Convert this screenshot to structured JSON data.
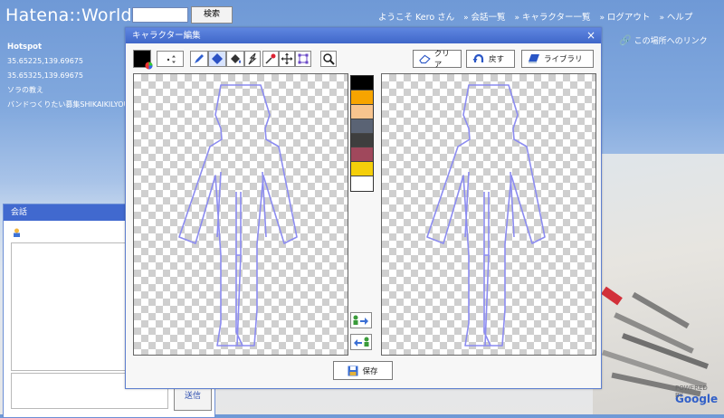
{
  "topbar": {
    "logo": "Hatena::World",
    "search_label": "検索",
    "greeting": "ようこそ Kero さん",
    "nav": [
      "会話一覧",
      "キャラクター一覧",
      "ログアウト",
      "ヘルプ"
    ],
    "link_here": "この場所へのリンク"
  },
  "sidepanel": {
    "heading": "Hotspot",
    "items": [
      "35.65225,139.69675",
      "35.65325,139.69675",
      "ソラの教え",
      "バンドつくりたい募集SHIKAIKILYOU"
    ]
  },
  "chat": {
    "title": "会話",
    "send_label": "送信"
  },
  "editor": {
    "title": "キャラクター編集",
    "close": "×",
    "buttons": {
      "clear": "クリア",
      "undo": "戻す",
      "library": "ライブラリ",
      "save": "保存"
    },
    "current_color": "#000000",
    "palette": [
      "#000000",
      "#f7a400",
      "#f7c48e",
      "#5a6374",
      "#3e3e3e",
      "#a0485c",
      "#f5cf0a",
      "#ffffff"
    ],
    "outline_color": "#8c8cf0"
  },
  "map": {
    "brand": "Google",
    "brand_prefix": "POWERED BY"
  }
}
